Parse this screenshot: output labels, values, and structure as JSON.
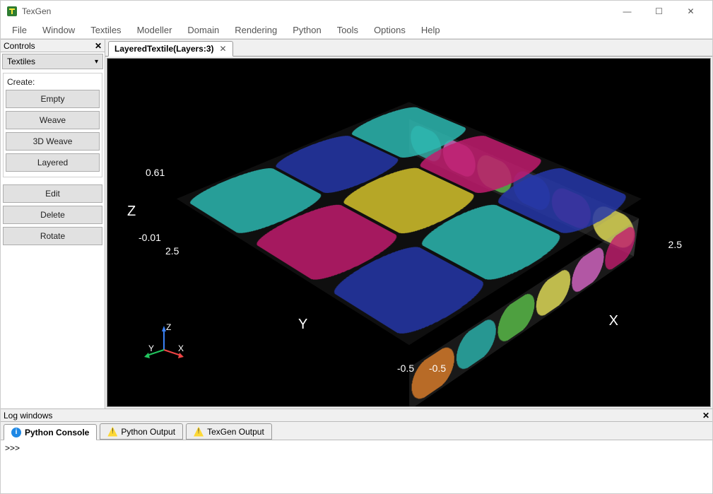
{
  "app": {
    "title": "TexGen"
  },
  "window_buttons": {
    "min": "—",
    "max": "☐",
    "close": "✕"
  },
  "menubar": [
    "File",
    "Window",
    "Textiles",
    "Modeller",
    "Domain",
    "Rendering",
    "Python",
    "Tools",
    "Options",
    "Help"
  ],
  "controls": {
    "panel_title": "Controls",
    "dropdown_value": "Textiles",
    "group_label": "Create:",
    "create_buttons": [
      "Empty",
      "Weave",
      "3D Weave",
      "Layered"
    ],
    "action_buttons": [
      "Edit",
      "Delete",
      "Rotate"
    ]
  },
  "tab": {
    "label": "LayeredTextile(Layers:3)"
  },
  "axes": {
    "z_label": "Z",
    "z_max": "0.61",
    "z_min": "-0.01",
    "y_label": "Y",
    "y_max": "2.5",
    "y_min": "-0.5",
    "x_label": "X",
    "x_max": "2.5",
    "x_min": "-0.5"
  },
  "triad": {
    "x": "X",
    "y": "Y",
    "z": "Z"
  },
  "top_colors": [
    "#2bb7b0",
    "#2536a8",
    "#2bb7b0",
    "#c01b6d",
    "#d4c22b",
    "#c01b6d",
    "#2536a8",
    "#2bb7b0",
    "#2536a8"
  ],
  "front_colors": [
    "#e07f2b",
    "#2bb7b0",
    "#5bc24a",
    "#e8e35a",
    "#d867c7",
    "#c01b6d"
  ],
  "right_colors": [
    "#2bb7b0",
    "#d867c7",
    "#5bc24a",
    "#2536a8",
    "#c01b6d",
    "#e8e35a"
  ],
  "log": {
    "panel_title": "Log windows",
    "tabs": [
      "Python Console",
      "Python Output",
      "TexGen Output"
    ],
    "prompt": ">>> "
  }
}
